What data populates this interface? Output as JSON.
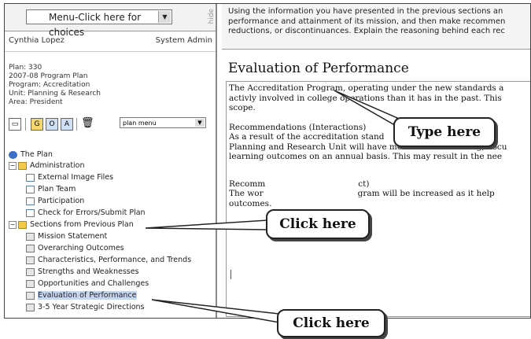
{
  "left_panel": {
    "menu_select": "Menu-Click here for choices",
    "hide_label": "hide",
    "user_name": "Cynthia Lopez",
    "user_role": "System Admin",
    "plan_info": [
      "Plan: 330",
      "2007-08 Program Plan",
      "Program: Accreditation",
      "Unit: Planning & Research",
      "Area: President"
    ],
    "toolbar": {
      "plan_menu": "plan menu"
    },
    "tree": {
      "root": "The Plan",
      "administration": "Administration",
      "admin_items": [
        "External Image Files",
        "Plan Team",
        "Participation",
        "Check for Errors/Submit Plan"
      ],
      "sections": "Sections from Previous Plan",
      "section_items": [
        "Mission Statement",
        "Overarching Outcomes",
        "Characteristics, Performance, and Trends",
        "Strengths and Weaknesses",
        "Opportunities and Challenges",
        "Evaluation of Performance",
        "3-5 Year Strategic Directions"
      ]
    }
  },
  "instructions": [
    "Using the information you have presented in the previous sections an",
    "performance and attainment of its mission, and then make recommen",
    "reductions, or discontinuances. Explain the reasoning behind each rec"
  ],
  "editor": {
    "title": "Evaluation of Performance",
    "p1": [
      "The Accreditation Program, operating under the new standards a",
      "activly involved in college operations than it has in the past.  This",
      "scope."
    ],
    "p2": [
      "Recommendations (Interactions)",
      "As a result of the accreditation stand",
      "Planning and Research Unit will have more work measuring, docu",
      "learning outcomes on an annual basis.  This may result in the nee"
    ],
    "p3": [
      "Recomm",
      "ct)",
      "The wor",
      "gram will be increased as it help",
      "outcomes."
    ]
  },
  "callouts": {
    "type_here": "Type here",
    "click_here_1": "Click here",
    "click_here_2": "Click here"
  },
  "colors": {
    "selected": "#c6d6ee",
    "folder": "#f3c94a"
  }
}
